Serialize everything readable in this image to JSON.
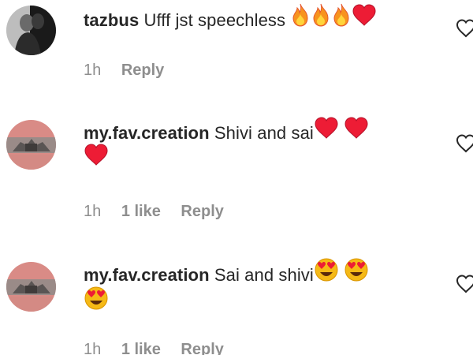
{
  "comments": [
    {
      "username": "tazbus",
      "text": "Ufff jst speechless",
      "emojis": [
        "fire",
        "fire",
        "fire",
        "red-heart"
      ],
      "time": "1h",
      "likes": "",
      "reply_label": "Reply"
    },
    {
      "username": "my.fav.creation",
      "text": "Shivi and sai",
      "emojis": [
        "red-heart",
        "red-heart",
        "red-heart"
      ],
      "time": "1h",
      "likes": "1 like",
      "reply_label": "Reply"
    },
    {
      "username": "my.fav.creation",
      "text": "Sai and shivi",
      "emojis": [
        "heart-eyes",
        "heart-eyes",
        "heart-eyes"
      ],
      "time": "1h",
      "likes": "1 like",
      "reply_label": "Reply"
    }
  ],
  "colors": {
    "username": "#262626",
    "meta": "#8e8e8e",
    "heart": "#ed1c35",
    "fire": "#f7931e",
    "emoji_face": "#f5b916"
  }
}
